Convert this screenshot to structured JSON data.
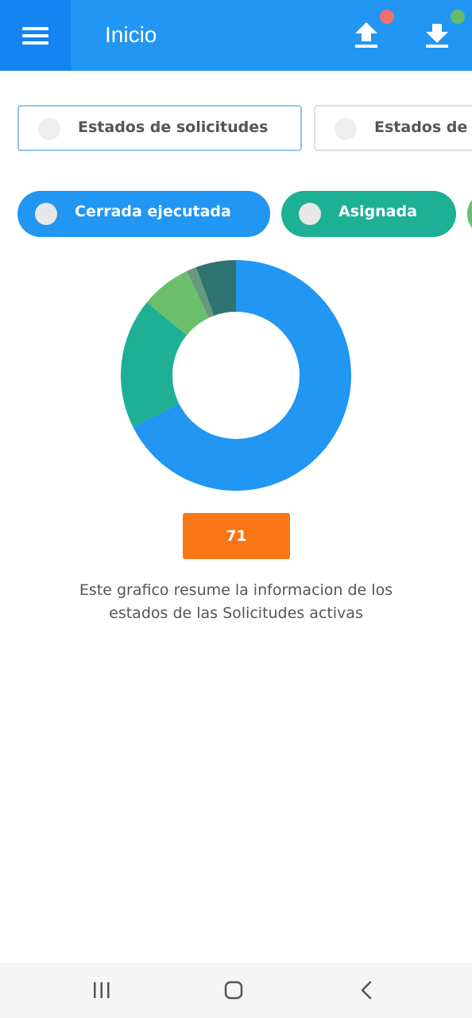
{
  "app_bar": {
    "title": "Inicio",
    "menu_icon": "hamburger-menu-icon",
    "upload_icon": "upload-icon",
    "download_icon": "download-icon",
    "upload_dot_color": "#ef7070",
    "download_dot_color": "#66bb6a",
    "background_color": "#2196f3"
  },
  "tabs": [
    {
      "label": "Estados de solicitudes",
      "selected": true
    },
    {
      "label": "Estados de l",
      "selected": false
    }
  ],
  "filter_chips": [
    {
      "label": "Cerrada ejecutada",
      "color": "#2196f3"
    },
    {
      "label": "Asignada",
      "color": "#1eb094"
    },
    {
      "label": "",
      "color": "#6bbf6b"
    }
  ],
  "chart_data": {
    "type": "pie",
    "style": "donut",
    "total": 71,
    "slices": [
      {
        "value": 48,
        "color": "#2196f3"
      },
      {
        "value": 13,
        "color": "#1eb094"
      },
      {
        "value": 5,
        "color": "#6bbf6b"
      },
      {
        "value": 1,
        "color": "#659a7e"
      },
      {
        "value": 4,
        "color": "#2e7370"
      }
    ],
    "start_angle_deg": 0,
    "direction": "clockwise"
  },
  "count_badge": {
    "value": "71",
    "color": "#f97616"
  },
  "caption": {
    "line1": "Este grafico resume la informacion de los",
    "line2": "estados de las Solicitudes activas"
  },
  "system_nav": {
    "recents_icon": "recent-apps-icon",
    "home_icon": "home-icon",
    "back_icon": "back-icon"
  }
}
